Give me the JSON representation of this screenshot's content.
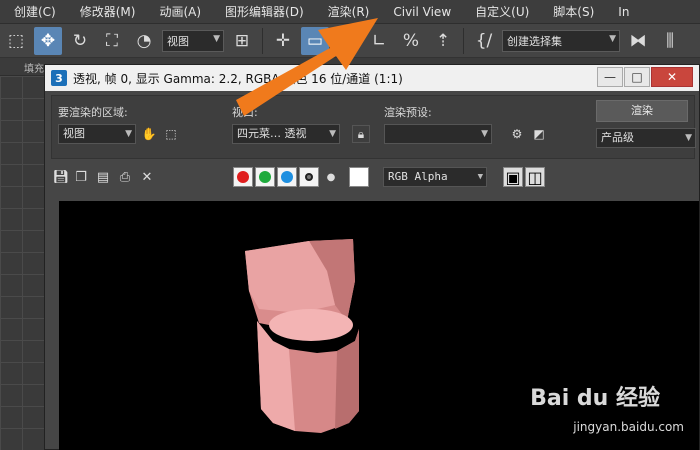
{
  "menu": [
    "创建(C)",
    "修改器(M)",
    "动画(A)",
    "图形编辑器(D)",
    "渲染(R)",
    "Civil View",
    "自定义(U)",
    "脚本(S)",
    "In"
  ],
  "toolbar": {
    "viewport_select": "视图",
    "selection_set": "创建选择集"
  },
  "strip": {
    "label": "填充"
  },
  "frame_window": {
    "icon_text": "3",
    "title": "透视, 帧 0, 显示 Gamma: 2.2, RGBA 颜色 16 位/通道 (1:1)",
    "min_label": "—",
    "max_label": "□",
    "close_label": "✕"
  },
  "settings": {
    "area_label": "要渲染的区域:",
    "area_value": "视图",
    "viewport_label": "视口:",
    "viewport_value": "四元菜… 透视",
    "preset_label": "渲染预设:",
    "preset_value": "",
    "render_button": "渲染",
    "quality_value": "产品级"
  },
  "channels": {
    "display_value": "RGB Alpha"
  },
  "watermark": {
    "brand": "Bai du 经验",
    "url": "jingyan.baidu.com"
  },
  "colors": {
    "accent": "#5a86b5",
    "annotation_arrow": "#f07a1c",
    "chair": "#e79a9a"
  }
}
